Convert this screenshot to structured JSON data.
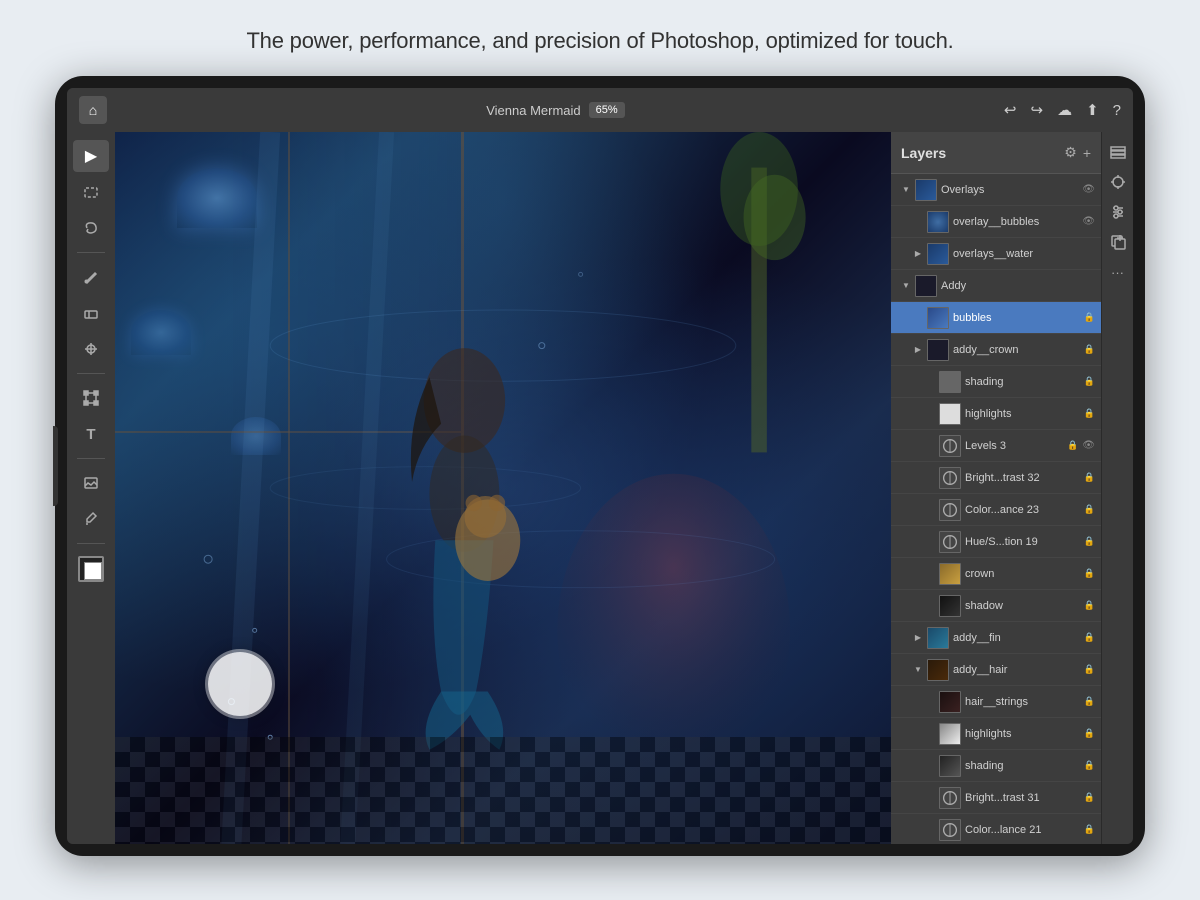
{
  "tagline": "The power, performance, and precision of Photoshop, optimized for touch.",
  "topbar": {
    "filename": "Vienna Mermaid",
    "zoom": "65%",
    "home_label": "⌂"
  },
  "layers_panel": {
    "title": "Layers",
    "layers": [
      {
        "id": 1,
        "name": "Overlays",
        "type": "group",
        "indent": 0,
        "expanded": true,
        "locked": false,
        "thumb_class": "lt-blue"
      },
      {
        "id": 2,
        "name": "overlay__bubbles",
        "type": "layer",
        "indent": 1,
        "expanded": false,
        "locked": false,
        "thumb_class": "lt-bubbles"
      },
      {
        "id": 3,
        "name": "overlays__water",
        "type": "group",
        "indent": 1,
        "expanded": false,
        "locked": false,
        "thumb_class": "lt-blue"
      },
      {
        "id": 4,
        "name": "Addy",
        "type": "group",
        "indent": 0,
        "expanded": true,
        "locked": false,
        "thumb_class": "lt-dark"
      },
      {
        "id": 5,
        "name": "bubbles",
        "type": "layer",
        "indent": 1,
        "expanded": false,
        "locked": true,
        "selected": true,
        "thumb_class": "lt-selected"
      },
      {
        "id": 6,
        "name": "addy__crown",
        "type": "group",
        "indent": 1,
        "expanded": false,
        "locked": true,
        "thumb_class": "lt-dark"
      },
      {
        "id": 7,
        "name": "shading",
        "type": "layer",
        "indent": 2,
        "expanded": false,
        "locked": true,
        "thumb_class": "lt-gray"
      },
      {
        "id": 8,
        "name": "highlights",
        "type": "layer",
        "indent": 2,
        "expanded": false,
        "locked": true,
        "thumb_class": "lt-white"
      },
      {
        "id": 9,
        "name": "Levels 3",
        "type": "adjustment",
        "indent": 2,
        "expanded": false,
        "locked": true,
        "thumb_class": "lt-levels"
      },
      {
        "id": 10,
        "name": "Bright...trast 32",
        "type": "adjustment",
        "indent": 2,
        "expanded": false,
        "locked": true,
        "thumb_class": "lt-bright"
      },
      {
        "id": 11,
        "name": "Color...ance 23",
        "type": "adjustment",
        "indent": 2,
        "expanded": false,
        "locked": true,
        "thumb_class": "lt-color"
      },
      {
        "id": 12,
        "name": "Hue/S...tion 19",
        "type": "adjustment",
        "indent": 2,
        "expanded": false,
        "locked": true,
        "thumb_class": "lt-hue"
      },
      {
        "id": 13,
        "name": "crown",
        "type": "layer",
        "indent": 2,
        "expanded": false,
        "locked": true,
        "thumb_class": "lt-crown"
      },
      {
        "id": 14,
        "name": "shadow",
        "type": "layer",
        "indent": 2,
        "expanded": false,
        "locked": true,
        "thumb_class": "lt-shadow"
      },
      {
        "id": 15,
        "name": "addy__fin",
        "type": "group",
        "indent": 1,
        "expanded": false,
        "locked": true,
        "thumb_class": "lt-fin"
      },
      {
        "id": 16,
        "name": "addy__hair",
        "type": "group",
        "indent": 1,
        "expanded": true,
        "locked": true,
        "thumb_class": "lt-hair"
      },
      {
        "id": 17,
        "name": "hair__strings",
        "type": "layer",
        "indent": 2,
        "expanded": false,
        "locked": true,
        "thumb_class": "lt-hair-str"
      },
      {
        "id": 18,
        "name": "highlights",
        "type": "layer",
        "indent": 2,
        "expanded": false,
        "locked": true,
        "thumb_class": "lt-highlight"
      },
      {
        "id": 19,
        "name": "shading",
        "type": "layer",
        "indent": 2,
        "expanded": false,
        "locked": true,
        "thumb_class": "lt-shading"
      },
      {
        "id": 20,
        "name": "Bright...trast 31",
        "type": "adjustment",
        "indent": 2,
        "expanded": false,
        "locked": true,
        "thumb_class": "lt-bright"
      },
      {
        "id": 21,
        "name": "Color...lance 21",
        "type": "adjustment",
        "indent": 2,
        "expanded": false,
        "locked": true,
        "thumb_class": "lt-color"
      }
    ]
  },
  "toolbar": {
    "tools": [
      {
        "name": "select-tool",
        "icon": "▶",
        "active": false
      },
      {
        "name": "marquee-tool",
        "icon": "⬡",
        "active": false
      },
      {
        "name": "lasso-tool",
        "icon": "⌒",
        "active": false
      },
      {
        "name": "brush-tool",
        "icon": "✏",
        "active": false
      },
      {
        "name": "eraser-tool",
        "icon": "◻",
        "active": false
      },
      {
        "name": "clone-tool",
        "icon": "⊕",
        "active": false
      },
      {
        "name": "transform-tool",
        "icon": "⤡",
        "active": false
      },
      {
        "name": "type-tool",
        "icon": "T",
        "active": false
      },
      {
        "name": "image-tool",
        "icon": "⬜",
        "active": false
      },
      {
        "name": "eyedropper-tool",
        "icon": "✒",
        "active": false
      }
    ]
  }
}
